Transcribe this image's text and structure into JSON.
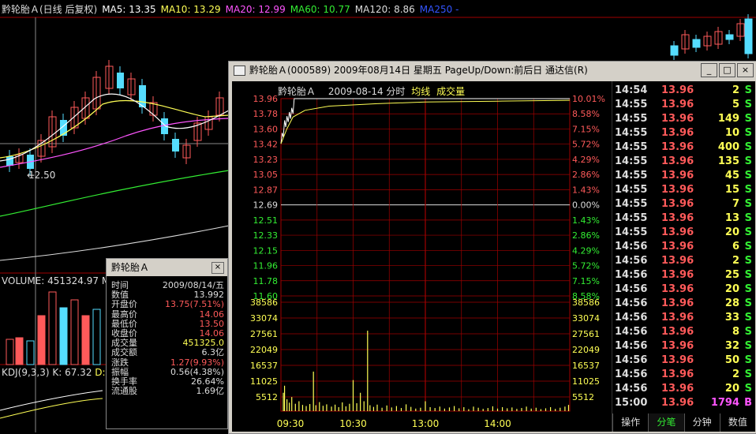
{
  "background_chart": {
    "ma_legend": [
      {
        "label": "黔轮胎Ａ(日线 后复权)",
        "color": "#dddddd"
      },
      {
        "label": "MA5: 13.35",
        "color": "#ffffff"
      },
      {
        "label": "MA10: 13.29",
        "color": "#ffff55"
      },
      {
        "label": "MA20: 12.99",
        "color": "#ff55ff"
      },
      {
        "label": "MA60: 10.77",
        "color": "#33ee33"
      },
      {
        "label": "MA120: 8.86",
        "color": "#dddddd"
      },
      {
        "label": "MA250 -",
        "color": "#3355ff"
      }
    ],
    "low_marker": "12.50",
    "volume_label": "VOLUME: 451324.97",
    "volume_suffix": "MA",
    "kdj_label": "KDJ(9,3,3)",
    "kdj_k": "K: 67.32",
    "kdj_d": "D: 6"
  },
  "info_panel": {
    "title": "黔轮胎Ａ",
    "close_label": "×",
    "rows": [
      {
        "key": "时间",
        "value": "2009/08/14/五",
        "color": "#dddddd"
      },
      {
        "key": "数值",
        "value": "13.992",
        "color": "#dddddd"
      },
      {
        "key": "开盘价",
        "value": "13.75(7.51%)",
        "color": "#ff5a5a"
      },
      {
        "key": "最高价",
        "value": "14.06",
        "color": "#ff5a5a"
      },
      {
        "key": "最低价",
        "value": "13.50",
        "color": "#ff5a5a"
      },
      {
        "key": "收盘价",
        "value": "14.06",
        "color": "#ff5a5a"
      },
      {
        "key": "成交量",
        "value": "451325.0",
        "color": "#ffff55"
      },
      {
        "key": "成交额",
        "value": "6.3亿",
        "color": "#dddddd"
      },
      {
        "key": "涨跌",
        "value": "1.27(9.93%)",
        "color": "#ff5a5a"
      },
      {
        "key": "振幅",
        "value": "0.56(4.38%)",
        "color": "#dddddd"
      },
      {
        "key": "换手率",
        "value": "26.64%",
        "color": "#dddddd"
      },
      {
        "key": "流通股",
        "value": "1.69亿",
        "color": "#dddddd"
      }
    ]
  },
  "window": {
    "title": "黔轮胎Ａ(000589) 2009年08月14日 星期五 PageUp/Down:前后日 通达信(R)",
    "buttons": [
      "_",
      "□",
      "×"
    ],
    "chart_header": {
      "name": "黔轮胎Ａ",
      "date": "2009-08-14 分时",
      "avg": "均线",
      "vol": "成交量"
    },
    "tabs": [
      "操作",
      "分笔",
      "分钟",
      "数值"
    ],
    "active_tab": 1
  },
  "chart_data": {
    "type": "line",
    "price_axis": {
      "left_labels": [
        "13.96",
        "13.78",
        "13.60",
        "13.42",
        "13.23",
        "13.05",
        "12.87",
        "12.69",
        "12.51",
        "12.33",
        "12.15",
        "11.96",
        "11.78",
        "11.60"
      ],
      "right_labels": [
        "10.01%",
        "8.58%",
        "7.15%",
        "5.72%",
        "4.29%",
        "2.86%",
        "1.43%",
        "0.00%",
        "1.43%",
        "2.86%",
        "4.29%",
        "5.72%",
        "7.15%",
        "8.58%"
      ],
      "ylim": [
        11.6,
        13.96
      ],
      "prev_close": 12.69
    },
    "volume_axis": {
      "labels": [
        "38586",
        "33074",
        "27561",
        "22049",
        "16537",
        "11025",
        "5512"
      ],
      "ylim": [
        0,
        38586
      ]
    },
    "time_labels": [
      "09:30",
      "10:30",
      "13:00",
      "14:00"
    ],
    "price_series": [
      {
        "name": "价格",
        "color": "#ffffff",
        "points": [
          [
            0,
            13.42
          ],
          [
            1,
            13.55
          ],
          [
            2,
            13.5
          ],
          [
            3,
            13.7
          ],
          [
            4,
            13.62
          ],
          [
            5,
            13.75
          ],
          [
            6,
            13.68
          ],
          [
            7,
            13.8
          ],
          [
            8,
            13.72
          ],
          [
            9,
            13.85
          ],
          [
            10,
            13.78
          ],
          [
            11,
            13.96
          ],
          [
            60,
            13.96
          ],
          [
            120,
            13.96
          ],
          [
            180,
            13.96
          ],
          [
            240,
            13.96
          ]
        ]
      },
      {
        "name": "均线",
        "color": "#ffff55",
        "points": [
          [
            0,
            13.42
          ],
          [
            5,
            13.6
          ],
          [
            10,
            13.74
          ],
          [
            20,
            13.82
          ],
          [
            40,
            13.87
          ],
          [
            80,
            13.9
          ],
          [
            120,
            13.92
          ],
          [
            180,
            13.93
          ],
          [
            240,
            13.94
          ]
        ]
      }
    ],
    "volume_bars": [
      {
        "t": 2,
        "v": 6500
      },
      {
        "t": 3,
        "v": 9000
      },
      {
        "t": 5,
        "v": 4200
      },
      {
        "t": 7,
        "v": 3000
      },
      {
        "t": 9,
        "v": 5000
      },
      {
        "t": 12,
        "v": 2600
      },
      {
        "t": 15,
        "v": 3500
      },
      {
        "t": 18,
        "v": 2200
      },
      {
        "t": 21,
        "v": 1800
      },
      {
        "t": 24,
        "v": 2500
      },
      {
        "t": 27,
        "v": 14000
      },
      {
        "t": 29,
        "v": 2100
      },
      {
        "t": 32,
        "v": 3200
      },
      {
        "t": 35,
        "v": 1900
      },
      {
        "t": 38,
        "v": 2400
      },
      {
        "t": 42,
        "v": 1600
      },
      {
        "t": 45,
        "v": 2300
      },
      {
        "t": 48,
        "v": 1400
      },
      {
        "t": 51,
        "v": 3100
      },
      {
        "t": 54,
        "v": 1700
      },
      {
        "t": 57,
        "v": 2600
      },
      {
        "t": 60,
        "v": 11000
      },
      {
        "t": 63,
        "v": 2800
      },
      {
        "t": 66,
        "v": 6500
      },
      {
        "t": 69,
        "v": 3500
      },
      {
        "t": 72,
        "v": 28500
      },
      {
        "t": 74,
        "v": 2100
      },
      {
        "t": 77,
        "v": 1500
      },
      {
        "t": 80,
        "v": 2300
      },
      {
        "t": 84,
        "v": 1200
      },
      {
        "t": 88,
        "v": 2000
      },
      {
        "t": 92,
        "v": 1300
      },
      {
        "t": 96,
        "v": 1800
      },
      {
        "t": 100,
        "v": 1100
      },
      {
        "t": 104,
        "v": 2400
      },
      {
        "t": 108,
        "v": 1500
      },
      {
        "t": 112,
        "v": 900
      },
      {
        "t": 116,
        "v": 1200
      },
      {
        "t": 120,
        "v": 3500
      },
      {
        "t": 124,
        "v": 1400
      },
      {
        "t": 128,
        "v": 1100
      },
      {
        "t": 132,
        "v": 1600
      },
      {
        "t": 136,
        "v": 900
      },
      {
        "t": 140,
        "v": 1300
      },
      {
        "t": 144,
        "v": 1800
      },
      {
        "t": 148,
        "v": 1000
      },
      {
        "t": 152,
        "v": 1400
      },
      {
        "t": 156,
        "v": 700
      },
      {
        "t": 160,
        "v": 1600
      },
      {
        "t": 164,
        "v": 1200
      },
      {
        "t": 168,
        "v": 800
      },
      {
        "t": 172,
        "v": 1100
      },
      {
        "t": 176,
        "v": 1700
      },
      {
        "t": 180,
        "v": 900
      },
      {
        "t": 184,
        "v": 1400
      },
      {
        "t": 188,
        "v": 1000
      },
      {
        "t": 192,
        "v": 1300
      },
      {
        "t": 196,
        "v": 800
      },
      {
        "t": 200,
        "v": 1100
      },
      {
        "t": 204,
        "v": 1600
      },
      {
        "t": 208,
        "v": 900
      },
      {
        "t": 212,
        "v": 1200
      },
      {
        "t": 216,
        "v": 700
      },
      {
        "t": 220,
        "v": 1000
      },
      {
        "t": 224,
        "v": 1400
      },
      {
        "t": 228,
        "v": 800
      },
      {
        "t": 232,
        "v": 1200
      },
      {
        "t": 236,
        "v": 1600
      },
      {
        "t": 239,
        "v": 2200
      }
    ],
    "xlim": [
      0,
      240
    ]
  },
  "ticks": [
    {
      "time": "14:54",
      "price": "13.96",
      "vol": "2",
      "dir": "S"
    },
    {
      "time": "14:55",
      "price": "13.96",
      "vol": "5",
      "dir": "S"
    },
    {
      "time": "14:55",
      "price": "13.96",
      "vol": "149",
      "dir": "S"
    },
    {
      "time": "14:55",
      "price": "13.96",
      "vol": "10",
      "dir": "S"
    },
    {
      "time": "14:55",
      "price": "13.96",
      "vol": "400",
      "dir": "S"
    },
    {
      "time": "14:55",
      "price": "13.96",
      "vol": "135",
      "dir": "S"
    },
    {
      "time": "14:55",
      "price": "13.96",
      "vol": "45",
      "dir": "S"
    },
    {
      "time": "14:55",
      "price": "13.96",
      "vol": "15",
      "dir": "S"
    },
    {
      "time": "14:55",
      "price": "13.96",
      "vol": "7",
      "dir": "S"
    },
    {
      "time": "14:55",
      "price": "13.96",
      "vol": "13",
      "dir": "S"
    },
    {
      "time": "14:55",
      "price": "13.96",
      "vol": "20",
      "dir": "S"
    },
    {
      "time": "14:56",
      "price": "13.96",
      "vol": "6",
      "dir": "S"
    },
    {
      "time": "14:56",
      "price": "13.96",
      "vol": "2",
      "dir": "S"
    },
    {
      "time": "14:56",
      "price": "13.96",
      "vol": "25",
      "dir": "S"
    },
    {
      "time": "14:56",
      "price": "13.96",
      "vol": "20",
      "dir": "S"
    },
    {
      "time": "14:56",
      "price": "13.96",
      "vol": "28",
      "dir": "S"
    },
    {
      "time": "14:56",
      "price": "13.96",
      "vol": "33",
      "dir": "S"
    },
    {
      "time": "14:56",
      "price": "13.96",
      "vol": "8",
      "dir": "S"
    },
    {
      "time": "14:56",
      "price": "13.96",
      "vol": "32",
      "dir": "S"
    },
    {
      "time": "14:56",
      "price": "13.96",
      "vol": "50",
      "dir": "S"
    },
    {
      "time": "14:56",
      "price": "13.96",
      "vol": "2",
      "dir": "S"
    },
    {
      "time": "14:56",
      "price": "13.96",
      "vol": "20",
      "dir": "S"
    },
    {
      "time": "15:00",
      "price": "13.96",
      "vol": "1794",
      "dir": "B"
    }
  ],
  "colors": {
    "up": "#ff5a5a",
    "down": "#33ee33",
    "grid": "#a00000",
    "buy": "#ff55ff",
    "sell": "#33ee33"
  }
}
